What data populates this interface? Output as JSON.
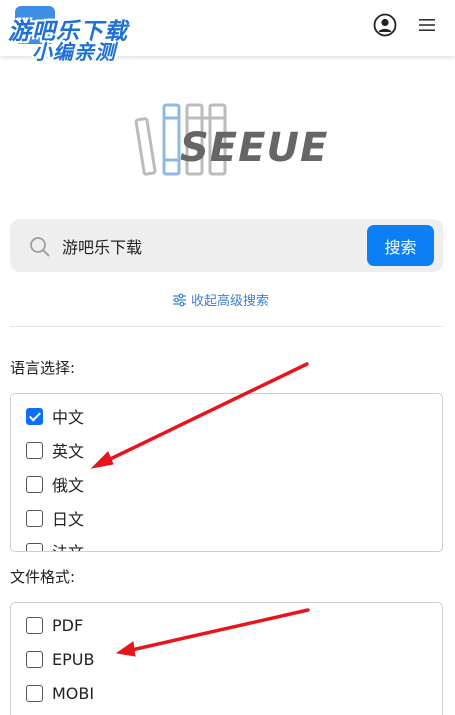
{
  "header": {
    "logo_line1": "游吧乐下载",
    "logo_line2": "小编亲测"
  },
  "brand": {
    "wordmark": "SEEUE"
  },
  "search": {
    "value": "游吧乐下载",
    "button_label": "搜索",
    "toggle_advanced_label": "收起高级搜索"
  },
  "language": {
    "label": "语言选择:",
    "options": [
      {
        "label": "中文",
        "checked": true
      },
      {
        "label": "英文",
        "checked": false
      },
      {
        "label": "俄文",
        "checked": false
      },
      {
        "label": "日文",
        "checked": false
      },
      {
        "label": "法文",
        "checked": false
      }
    ]
  },
  "format": {
    "label": "文件格式:",
    "options": [
      {
        "label": "PDF",
        "checked": false
      },
      {
        "label": "EPUB",
        "checked": false
      },
      {
        "label": "MOBI",
        "checked": false
      }
    ]
  },
  "colors": {
    "accent": "#0d7ff4",
    "annotation_arrow": "#e8141b"
  },
  "icons": [
    "user-circle-icon",
    "hamburger-menu-icon",
    "search-icon",
    "filter-sliders-icon",
    "checkbox-icon"
  ]
}
